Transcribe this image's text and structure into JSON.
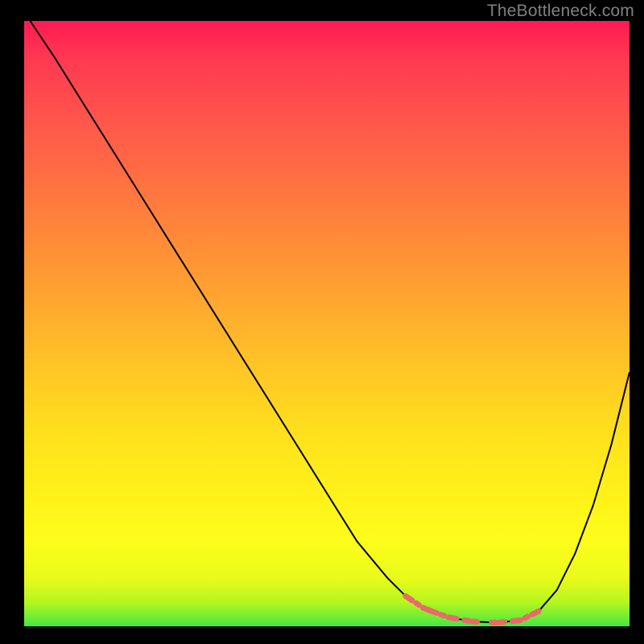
{
  "watermark": "TheBottleneck.com",
  "chart_data": {
    "type": "line",
    "title": "",
    "xlabel": "",
    "ylabel": "",
    "xlim": [
      0,
      100
    ],
    "ylim": [
      0,
      100
    ],
    "grid": false,
    "legend": false,
    "curve": {
      "name": "main-curve",
      "color": "#000000",
      "x": [
        1,
        5,
        10,
        15,
        20,
        25,
        30,
        35,
        40,
        45,
        50,
        55,
        60,
        63,
        66,
        70,
        74,
        78,
        82,
        85,
        88,
        91,
        94,
        97,
        100
      ],
      "y": [
        100,
        94,
        86,
        78,
        70,
        62,
        54,
        46,
        38,
        30,
        22,
        14,
        8,
        5,
        3,
        1.5,
        0.8,
        0.6,
        1.0,
        2.5,
        6,
        12,
        20,
        30,
        42
      ]
    },
    "highlight_segment": {
      "name": "low-bottleneck-zone",
      "color": "#e86a6a",
      "x": [
        63,
        66,
        70,
        74,
        78,
        82,
        85
      ],
      "y": [
        5,
        3,
        1.5,
        0.8,
        0.6,
        1.0,
        2.5
      ]
    },
    "background_gradient": {
      "top": "#ff1a53",
      "upper_mid": "#ff8c33",
      "mid": "#ffe01d",
      "lower_mid": "#fdfd1a",
      "bottom": "#44e842"
    }
  }
}
